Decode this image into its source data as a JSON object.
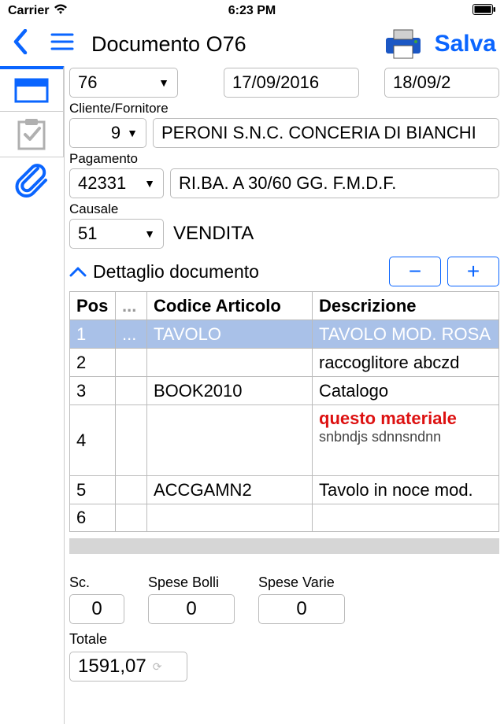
{
  "statusbar": {
    "carrier": "Carrier",
    "time": "6:23 PM"
  },
  "navbar": {
    "title": "Documento O76",
    "save": "Salva"
  },
  "header": {
    "doc_number": "76",
    "date1": "17/09/2016",
    "date2": "18/09/2",
    "cliente_label": "Cliente/Fornitore",
    "cliente_id": "9",
    "cliente_text": "PERONI S.N.C. CONCERIA DI BIANCHI",
    "pagamento_label": "Pagamento",
    "pagamento_id": "42331",
    "pagamento_text": "RI.BA. A 30/60 GG. F.M.D.F.",
    "causale_label": "Causale",
    "causale_id": "51",
    "causale_text": "VENDITA"
  },
  "detail": {
    "title": "Dettaglio documento",
    "cols": {
      "pos": "Pos",
      "dots": "...",
      "code": "Codice Articolo",
      "desc": "Descrizione"
    },
    "rows": [
      {
        "pos": "1",
        "code": "TAVOLO",
        "desc": "TAVOLO MOD. ROSA",
        "selected": true
      },
      {
        "pos": "2",
        "code": "",
        "desc": "raccoglitore abczd"
      },
      {
        "pos": "3",
        "code": "BOOK2010",
        "desc": "Catalogo"
      },
      {
        "pos": "4",
        "code": "",
        "desc_red": "questo materiale",
        "desc_sub": "snbndjs sdnnsndnn"
      },
      {
        "pos": "5",
        "code": "ACCGAMN2",
        "desc": "Tavolo in noce mod."
      },
      {
        "pos": "6",
        "code": "",
        "desc": ""
      }
    ]
  },
  "footer": {
    "sc_label": "Sc.",
    "spese_bolli_label": "Spese Bolli",
    "spese_varie_label": "Spese Varie",
    "sc": "0",
    "spese_bolli": "0",
    "spese_varie": "0",
    "totale_label": "Totale",
    "totale": "1591,07"
  }
}
